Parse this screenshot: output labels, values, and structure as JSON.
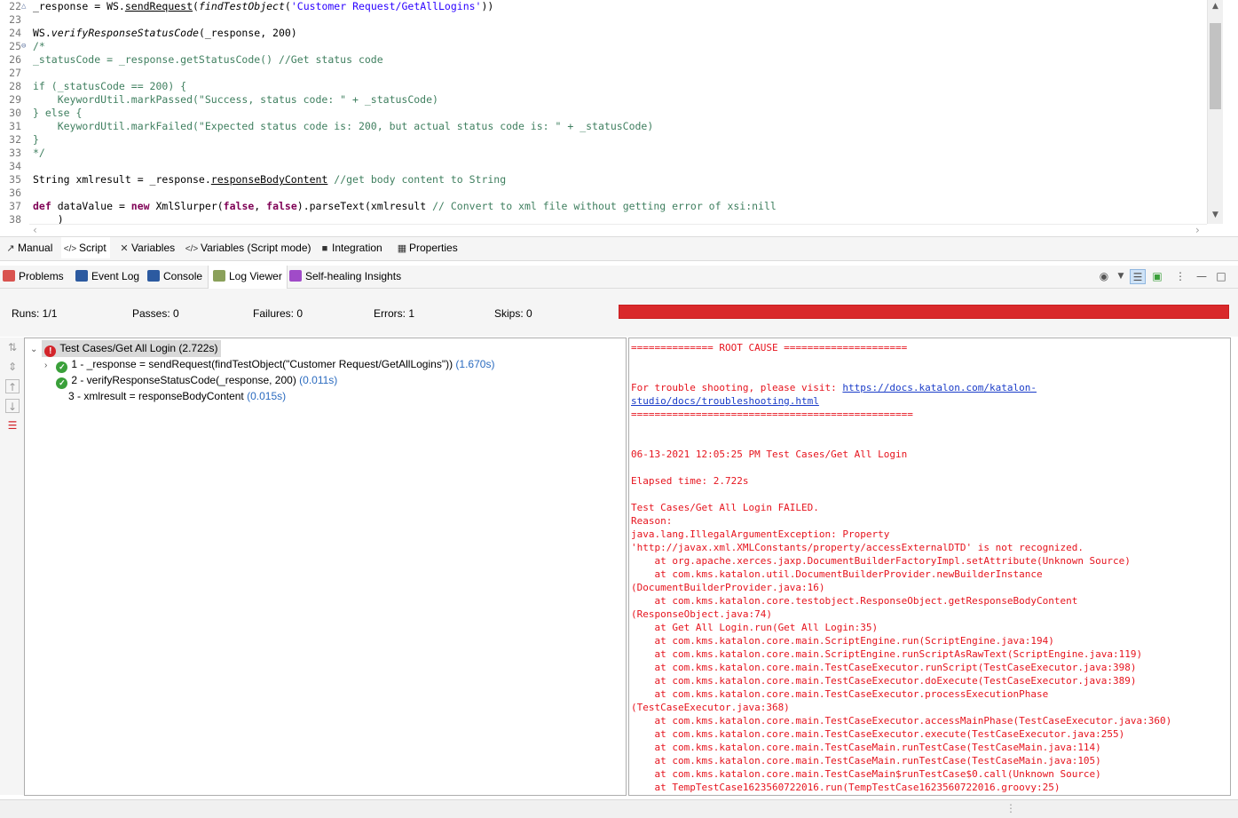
{
  "editor": {
    "lines": [
      {
        "n": "22",
        "fold": "△",
        "segs": [
          {
            "t": "_response = WS.",
            "c": ""
          },
          {
            "t": "sendRequest",
            "c": "ul"
          },
          {
            "t": "(",
            "c": ""
          },
          {
            "t": "findTestObject",
            "c": "it"
          },
          {
            "t": "(",
            "c": ""
          },
          {
            "t": "'Customer Request/GetAllLogins'",
            "c": "st"
          },
          {
            "t": "))",
            "c": ""
          }
        ]
      },
      {
        "n": "23",
        "fold": "",
        "segs": []
      },
      {
        "n": "24",
        "fold": "",
        "segs": [
          {
            "t": "WS.",
            "c": ""
          },
          {
            "t": "verifyResponseStatusCode",
            "c": "it"
          },
          {
            "t": "(_response, 200)",
            "c": ""
          }
        ]
      },
      {
        "n": "25",
        "fold": "⊖",
        "segs": [
          {
            "t": "/*",
            "c": "cm"
          }
        ]
      },
      {
        "n": "26",
        "fold": "",
        "segs": [
          {
            "t": "_statusCode = _response.getStatusCode() //Get status code",
            "c": "cm"
          }
        ]
      },
      {
        "n": "27",
        "fold": "",
        "segs": []
      },
      {
        "n": "28",
        "fold": "",
        "segs": [
          {
            "t": "if (_statusCode == 200) {",
            "c": "cm"
          }
        ]
      },
      {
        "n": "29",
        "fold": "",
        "segs": [
          {
            "t": "    KeywordUtil.markPassed(\"Success, status code: \" + _statusCode)",
            "c": "cm"
          }
        ]
      },
      {
        "n": "30",
        "fold": "",
        "segs": [
          {
            "t": "} else {",
            "c": "cm"
          }
        ]
      },
      {
        "n": "31",
        "fold": "",
        "segs": [
          {
            "t": "    KeywordUtil.markFailed(\"Expected status code is: 200, but actual status code is: \" + _statusCode)",
            "c": "cm"
          }
        ]
      },
      {
        "n": "32",
        "fold": "",
        "segs": [
          {
            "t": "}",
            "c": "cm"
          }
        ]
      },
      {
        "n": "33",
        "fold": "",
        "segs": [
          {
            "t": "*/",
            "c": "cm"
          }
        ]
      },
      {
        "n": "34",
        "fold": "",
        "segs": []
      },
      {
        "n": "35",
        "fold": "",
        "segs": [
          {
            "t": "String xmlresult = _response.",
            "c": ""
          },
          {
            "t": "responseBodyContent",
            "c": "ul"
          },
          {
            "t": " //get body content to String",
            "c": "cm"
          }
        ]
      },
      {
        "n": "36",
        "fold": "",
        "segs": []
      },
      {
        "n": "37",
        "fold": "",
        "segs": [
          {
            "t": "def",
            "c": "tb"
          },
          {
            "t": " dataValue = ",
            "c": ""
          },
          {
            "t": "new",
            "c": "tb"
          },
          {
            "t": " XmlSlurper(",
            "c": ""
          },
          {
            "t": "false",
            "c": "tb"
          },
          {
            "t": ", ",
            "c": ""
          },
          {
            "t": "false",
            "c": "tb"
          },
          {
            "t": ").parseText(xmlresult ",
            "c": ""
          },
          {
            "t": "// Convert to xml file without getting error of xsi:nill",
            "c": "cm"
          }
        ]
      },
      {
        "n": "38",
        "fold": "",
        "segs": [
          {
            "t": "    )",
            "c": ""
          }
        ]
      }
    ]
  },
  "editor_tabs": [
    {
      "label": "Manual",
      "icon": "↗",
      "icon_name": "manual-icon"
    },
    {
      "label": "Script",
      "icon": "</>",
      "icon_name": "script-icon"
    },
    {
      "label": "Variables",
      "icon": "✕",
      "icon_name": "variables-icon"
    },
    {
      "label": "Variables (Script mode)",
      "icon": "</>",
      "icon_name": "variables-script-icon"
    },
    {
      "label": "Integration",
      "icon": "■",
      "icon_name": "integration-icon"
    },
    {
      "label": "Properties",
      "icon": "▦",
      "icon_name": "properties-icon"
    }
  ],
  "panel_tabs": [
    {
      "label": "Problems",
      "color": "#d9534f",
      "icon_name": "problems-icon"
    },
    {
      "label": "Event Log",
      "color": "#2c5aa0",
      "icon_name": "event-log-icon"
    },
    {
      "label": "Console",
      "color": "#2c5aa0",
      "icon_name": "console-icon"
    },
    {
      "label": "Log Viewer",
      "color": "#8aa05a",
      "icon_name": "log-viewer-icon"
    },
    {
      "label": "Self-healing Insights",
      "color": "#a04bc8",
      "icon_name": "self-healing-icon"
    }
  ],
  "stats": {
    "runs": "Runs:  1/1",
    "passes": "Passes:  0",
    "failures": "Failures:  0",
    "errors": "Errors:  1",
    "skips": "Skips:  0",
    "progress_color": "#d9292b"
  },
  "tree": {
    "root": {
      "label": "Test Cases/Get All Login (2.722s)"
    },
    "steps": [
      {
        "label": "1 - _response = sendRequest(findTestObject(\"Customer Request/GetAllLogins\"))",
        "time": "(1.670s)",
        "status": "passed"
      },
      {
        "label": "2 - verifyResponseStatusCode(_response, 200)",
        "time": "(0.011s)",
        "status": "passed"
      },
      {
        "label": "3 - xmlresult = responseBodyContent",
        "time": "(0.015s)",
        "status": "none"
      }
    ]
  },
  "log": {
    "link": "https://docs.katalon.com/katalon-studio/docs/troubleshooting.html",
    "lines": [
      "============== ROOT CAUSE =====================",
      "",
      "",
      "For trouble shooting, please visit: ",
      "studio/docs/troubleshooting.html",
      "================================================",
      "",
      "",
      "06-13-2021 12:05:25 PM Test Cases/Get All Login",
      "",
      "Elapsed time: 2.722s",
      "",
      "Test Cases/Get All Login FAILED.",
      "Reason:",
      "java.lang.IllegalArgumentException: Property",
      "'http://javax.xml.XMLConstants/property/accessExternalDTD' is not recognized.",
      "    at org.apache.xerces.jaxp.DocumentBuilderFactoryImpl.setAttribute(Unknown Source)",
      "    at com.kms.katalon.util.DocumentBuilderProvider.newBuilderInstance",
      "(DocumentBuilderProvider.java:16)",
      "    at com.kms.katalon.core.testobject.ResponseObject.getResponseBodyContent",
      "(ResponseObject.java:74)",
      "    at Get All Login.run(Get All Login:35)",
      "    at com.kms.katalon.core.main.ScriptEngine.run(ScriptEngine.java:194)",
      "    at com.kms.katalon.core.main.ScriptEngine.runScriptAsRawText(ScriptEngine.java:119)",
      "    at com.kms.katalon.core.main.TestCaseExecutor.runScript(TestCaseExecutor.java:398)",
      "    at com.kms.katalon.core.main.TestCaseExecutor.doExecute(TestCaseExecutor.java:389)",
      "    at com.kms.katalon.core.main.TestCaseExecutor.processExecutionPhase",
      "(TestCaseExecutor.java:368)",
      "    at com.kms.katalon.core.main.TestCaseExecutor.accessMainPhase(TestCaseExecutor.java:360)",
      "    at com.kms.katalon.core.main.TestCaseExecutor.execute(TestCaseExecutor.java:255)",
      "    at com.kms.katalon.core.main.TestCaseMain.runTestCase(TestCaseMain.java:114)",
      "    at com.kms.katalon.core.main.TestCaseMain.runTestCase(TestCaseMain.java:105)",
      "    at com.kms.katalon.core.main.TestCaseMain$runTestCase$0.call(Unknown Source)",
      "    at TempTestCase1623560722016.run(TempTestCase1623560722016.groovy:25)"
    ]
  }
}
